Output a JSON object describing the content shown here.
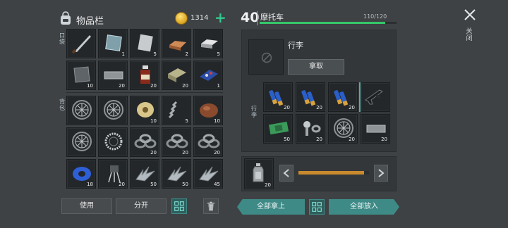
{
  "inventory": {
    "title": "物品栏",
    "coins": "1314",
    "plus_label": "+",
    "pocket_label": "口袋",
    "backpack_label": "背包",
    "pocket_items": [
      {
        "icon": "machete-icon",
        "qty": ""
      },
      {
        "icon": "glass-pane-icon",
        "qty": "1"
      },
      {
        "icon": "metal-sheet-icon",
        "qty": "5"
      },
      {
        "icon": "copper-ingot-icon",
        "qty": "2"
      },
      {
        "icon": "iron-ingot-icon",
        "qty": "5"
      },
      {
        "icon": "steel-plate-icon",
        "qty": "10"
      },
      {
        "icon": "metal-bar-icon",
        "qty": "20"
      },
      {
        "icon": "medicine-bottle-icon",
        "qty": "20"
      },
      {
        "icon": "cloth-icon",
        "qty": "20"
      },
      {
        "icon": "circuit-board-icon",
        "qty": "1"
      }
    ],
    "backpack_items": [
      {
        "icon": "wheel-icon",
        "qty": ""
      },
      {
        "icon": "wheel-icon",
        "qty": ""
      },
      {
        "icon": "wire-spool-icon",
        "qty": "10"
      },
      {
        "icon": "spring-icon",
        "qty": "5"
      },
      {
        "icon": "meat-icon",
        "qty": "10"
      },
      {
        "icon": "wheel-icon",
        "qty": ""
      },
      {
        "icon": "bearing-icon",
        "qty": ""
      },
      {
        "icon": "washer-icon",
        "qty": "20"
      },
      {
        "icon": "washer-icon",
        "qty": "20"
      },
      {
        "icon": "washer-icon",
        "qty": "20"
      },
      {
        "icon": "blue-tape-icon",
        "qty": "18"
      },
      {
        "icon": "transistor-icon",
        "qty": "20"
      },
      {
        "icon": "metal-scrap-icon",
        "qty": "50"
      },
      {
        "icon": "metal-scrap-icon",
        "qty": "50"
      },
      {
        "icon": "metal-scrap-icon",
        "qty": "45"
      }
    ],
    "use_label": "使用",
    "split_label": "分开"
  },
  "vehicle": {
    "level": "40",
    "name": "摩托车",
    "capacity": "110/120",
    "capacity_fraction": 0.917,
    "luggage_title": "行李",
    "take_label": "拿取",
    "storage_label": "行李",
    "items": [
      {
        "icon": "shotgun-shells-icon",
        "qty": "20"
      },
      {
        "icon": "shotgun-shells-icon",
        "qty": "20"
      },
      {
        "icon": "shotgun-shells-icon",
        "qty": "20"
      },
      {
        "icon": "assault-rifle-icon",
        "qty": ""
      },
      {
        "icon": "cash-bundle-icon",
        "qty": "50"
      },
      {
        "icon": "screw-icon",
        "qty": "20"
      },
      {
        "icon": "wheel-icon",
        "qty": "20"
      },
      {
        "icon": "metal-bar-icon",
        "qty": "20"
      }
    ],
    "fuel_item_qty": "20",
    "fuel_level": 0.93
  },
  "actions": {
    "take_all_label": "全部拿上",
    "put_all_label": "全部放入",
    "close_label": "关闭"
  },
  "colors": {
    "accent_green": "#35c66a",
    "teal": "#3e8a86",
    "fuel_orange": "#c98a2e"
  }
}
